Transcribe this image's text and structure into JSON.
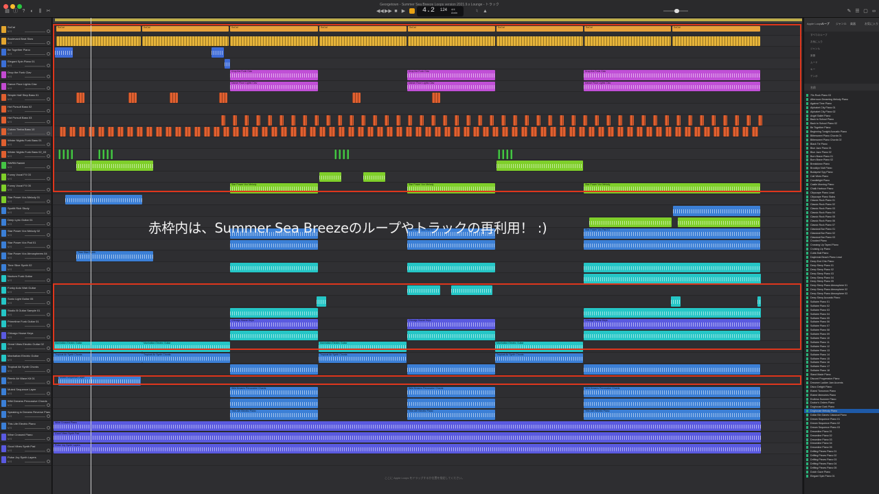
{
  "window": {
    "title": "Georgetown - Summer Sea Breeze Loops version 2021.9.x Lounge - トラック",
    "colors": {
      "close": "#ff5f57",
      "min": "#febc2e",
      "max": "#28c840"
    }
  },
  "transport": {
    "position": "4.2",
    "tempo": "124",
    "signature_top": "4/4",
    "signature_bottom": "Amin"
  },
  "annotation": {
    "text": "赤枠内は、Summer Sea Breezeのループやトラックの再利用！ :)",
    "box_color": "#e0361c"
  },
  "status_line": "ここに Apple Loops をドラッグするか位置を指定してください。",
  "tracks": [
    {
      "name": "SoCal",
      "color": "#e3a52e",
      "icon": "drummer-icon"
    },
    {
      "name": "Boulevard Beat Slow",
      "color": "#e3a52e",
      "icon": "drum-icon"
    },
    {
      "name": "Be Together Piano",
      "color": "#3b6fd6",
      "icon": "piano-icon"
    },
    {
      "name": "Elegant Spin Piano 01",
      "color": "#3b6fd6",
      "icon": "piano-icon"
    },
    {
      "name": "Drop the Funk Clav",
      "color": "#c34bd1",
      "icon": "keys-icon"
    },
    {
      "name": "Dance Floor Lights Clav",
      "color": "#c34bd1",
      "icon": "keys-icon"
    },
    {
      "name": "Simple Half Step Bass 01",
      "color": "#e06030",
      "icon": "bass-icon"
    },
    {
      "name": "Hot Pursuit Bass 02",
      "color": "#e06030",
      "icon": "bass-icon"
    },
    {
      "name": "Hot Pursuit Bass 03",
      "color": "#e06030",
      "icon": "bass-icon"
    },
    {
      "name": "Cuban Timba Bass 10",
      "color": "#e06030",
      "icon": "bass-icon"
    },
    {
      "name": "Winter Nights Funk Bass 01",
      "color": "#e06030",
      "icon": "bass-icon"
    },
    {
      "name": "Winter Nights Funk Bass 02_03",
      "color": "#e06030",
      "icon": "bass-icon"
    },
    {
      "name": "SWRB Rabbit",
      "color": "#45c445",
      "icon": "synth-icon"
    },
    {
      "name": "Funny Vocal FX 03",
      "color": "#7fcf2a",
      "icon": "mic-icon"
    },
    {
      "name": "Funny Vocal FX 05",
      "color": "#7fcf2a",
      "icon": "mic-icon"
    },
    {
      "name": "Star Power Vox Melody 01",
      "color": "#7fcf2a",
      "icon": "mic-icon"
    },
    {
      "name": "Spotlit Rich Study",
      "color": "#3b7fd6",
      "icon": "mic-icon"
    },
    {
      "name": "Deep Lyric Guitar 01",
      "color": "#3b7fd6",
      "icon": "guitar-icon"
    },
    {
      "name": "Star Power Vox Melody 02",
      "color": "#3b7fd6",
      "icon": "mic-icon"
    },
    {
      "name": "Star Power Vox Pad 01",
      "color": "#3b7fd6",
      "icon": "mic-icon"
    },
    {
      "name": "Star Power Vox Atmospheres 04",
      "color": "#3b7fd6",
      "icon": "mic-icon"
    },
    {
      "name": "Time Slice Synth 02",
      "color": "#3b7fd6",
      "icon": "synth-icon"
    },
    {
      "name": "Nocturn Funk Guitar",
      "color": "#25c6c6",
      "icon": "guitar-icon"
    },
    {
      "name": "Funky Auto Wah Guitar",
      "color": "#25c6c6",
      "icon": "guitar-icon"
    },
    {
      "name": "Sonic Light Guitar 05",
      "color": "#25c6c6",
      "icon": "guitar-icon"
    },
    {
      "name": "Studio B Guitar Sample 01",
      "color": "#25c6c6",
      "icon": "guitar-icon"
    },
    {
      "name": "Primetime Funk Guitar 01",
      "color": "#25c6c6",
      "icon": "guitar-icon"
    },
    {
      "name": "Chicago House Keys",
      "color": "#5a5ae0",
      "icon": "keys-icon"
    },
    {
      "name": "Great Vibes Electric Guitar 02",
      "color": "#25c6c6",
      "icon": "guitar-icon"
    },
    {
      "name": "Manhattan Electric Guitar",
      "color": "#25c6c6",
      "icon": "guitar-icon"
    },
    {
      "name": "Tropical Air Synth Chords",
      "color": "#3b7fd6",
      "icon": "synth-icon"
    },
    {
      "name": "Remix Air Wave Kit 01",
      "color": "#3b7fd6",
      "icon": "synth-icon"
    },
    {
      "name": "Muted Sequence Layer",
      "color": "#3b7fd6",
      "icon": "synth-icon"
    },
    {
      "name": "Wild Dreams Percussive Chords",
      "color": "#3b7fd6",
      "icon": "synth-icon"
    },
    {
      "name": "Speaking in Dreams Reverse Piano 03",
      "color": "#3b7fd6",
      "icon": "piano-icon"
    },
    {
      "name": "This Life Electric Piano",
      "color": "#3b7fd6",
      "icon": "piano-icon"
    },
    {
      "name": "Wine Crossed Piano",
      "color": "#5a5ae0",
      "icon": "piano-icon"
    },
    {
      "name": "Good Vibes Synth Pad",
      "color": "#5a5ae0",
      "icon": "synth-icon"
    },
    {
      "name": "Pulse Joy Synth Layers",
      "color": "#5a5ae0",
      "icon": "synth-icon"
    }
  ],
  "browser": {
    "tabs": [
      "Apple Loops",
      "ループ",
      "ジャンル",
      "楽器",
      "お気に入り"
    ],
    "header_label": "名前",
    "selected_index": 78,
    "items": [
      "70s Rock Piano 03",
      "Afternoon Dreaming Melody Piano",
      "Against Time Piano",
      "Alphabet City Piano 01",
      "Alphabet City Piano 02",
      "Angel Ballet Piano",
      "Back to School Piano",
      "Back to School Piano 02",
      "Be Together Piano",
      "Beginning Tonight Acoustic Piano",
      "Bittersweet Piano Chords 01",
      "Bittersweet Piano Chords 02",
      "Black Tie Piano",
      "Blue Jazz Piano 01",
      "Blue Jazz Piano 02",
      "Born Brave Piano 01",
      "Born Brave Piano 02",
      "Breakdown Piano",
      "Brooklyn Nuit Piano",
      "Budapest Spy Piano",
      "Cali Vibes Piano",
      "Candlelight Piano",
      "Castle Morning Piano",
      "Chalk Harbour Piano",
      "Cityscape Piano Lead",
      "Cityscape Piano Stabs",
      "Classic Rock Piano 01",
      "Classic Rock Piano 02",
      "Classic Rock Piano 03",
      "Classic Rock Piano 04",
      "Classic Rock Piano 05",
      "Classic Rock Piano 06",
      "Classic Rock Piano 07",
      "Classical Bar Piano 01",
      "Classical Bar Piano 02",
      "Classical Bar Piano 03",
      "Crooked Piano",
      "Crossing Up Taped Piano",
      "Cruising Up Piano",
      "Cubic Ball Piano",
      "Daybreak Beach Piano Lead",
      "Deep End Chic Piano",
      "Deep Sleep Piano 01",
      "Deep Sleep Piano 02",
      "Deep Sleep Piano 03",
      "Deep Sleep Piano 04",
      "Deep Sleep Piano 05",
      "Deep Sleep Piano Atmosphere 01",
      "Deep Sleep Piano Atmosphere 02",
      "Deep Sleep Piano Atmosphere 03",
      "Deep Sleep Acoustic Piano",
      "Solitaire Piano 01",
      "Solitaire Piano 02",
      "Solitaire Piano 03",
      "Solitaire Piano 04",
      "Solitaire Piano 05",
      "Solitaire Piano 06",
      "Solitaire Piano 07",
      "Solitaire Piano 08",
      "Solitaire Piano 09",
      "Solitaire Piano 10",
      "Solitaire Piano 11",
      "Solitaire Piano 12",
      "Solitaire Piano 13",
      "Solitaire Piano 14",
      "Solitaire Piano 15",
      "Solitaire Piano 16",
      "Solitaire Piano 17",
      "Solitaire Piano 18",
      "Stand Made Piano",
      "Discord Progression Piano",
      "Dreamer Ladder Jam Accents",
      "Disco Delight Piano",
      "Elated Tomorrow Piano",
      "Elated Memories Piano",
      "Endless Summer Piano",
      "Doctor's Orders Piano",
      "Doghouse Dark Piano",
      "Doghouse Melody Piano",
      "Dollar Bin Ganes Classical Piano",
      "Dream Sequence Piano 01",
      "Dream Sequence Piano 02",
      "Dream Sequence Piano 03",
      "Dreamline Piano 01",
      "Dreamline Piano 02",
      "Dreamline Piano 03",
      "Dreamline Piano 04",
      "Dreamline Piano 05",
      "Drifting Pieces Piano 01",
      "Drifting Pieces Piano 02",
      "Drifting Pieces Piano 03",
      "Drifting Pieces Piano 04",
      "Drifting Pieces Piano 05",
      "Dutch Gaze Piano",
      "Elegant Spin Piano 01"
    ],
    "top_rows": [
      "すべてのループ",
      "お気に入り",
      "ジャンル",
      "楽器",
      "ムード",
      "キー",
      "テンポ"
    ]
  }
}
